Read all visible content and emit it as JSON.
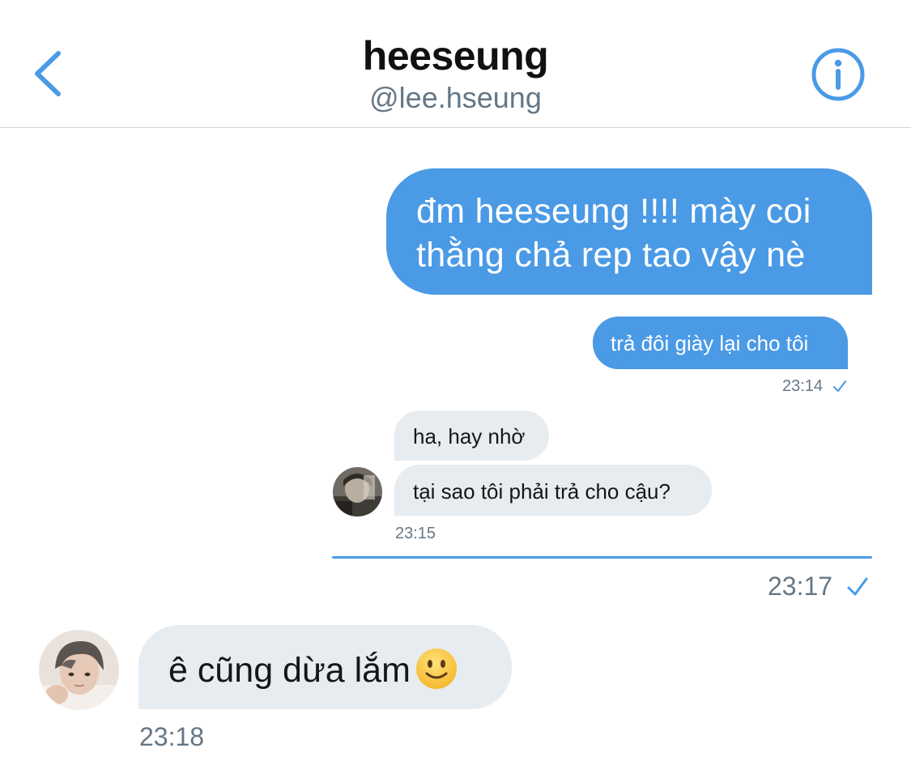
{
  "header": {
    "display_name": "heeseung",
    "username": "@lee.hseung"
  },
  "messages": [
    {
      "direction": "outgoing",
      "text": "đm heeseung !!!! mày coi thằng chả rep tao vậy nè"
    },
    {
      "direction": "outgoing",
      "text": "trả đôi giày lại cho tôi",
      "time": "23:14",
      "status": "sent"
    },
    {
      "direction": "incoming",
      "text": "ha, hay nhờ"
    },
    {
      "direction": "incoming",
      "text": "tại sao tôi phải trả cho cậu?",
      "time": "23:15"
    },
    {
      "direction": "incoming",
      "text": "ê cũng dừa lắm",
      "emoji": "slightly-smiling-face",
      "time": "23:18"
    }
  ],
  "shared_message_time": "23:17",
  "colors": {
    "accent": "#4a9ae6",
    "incoming_bubble": "#e6ecf0",
    "timestamp": "#657786"
  },
  "icons": {
    "back": "chevron-left-icon",
    "info": "info-circle-icon",
    "check": "checkmark-icon"
  }
}
